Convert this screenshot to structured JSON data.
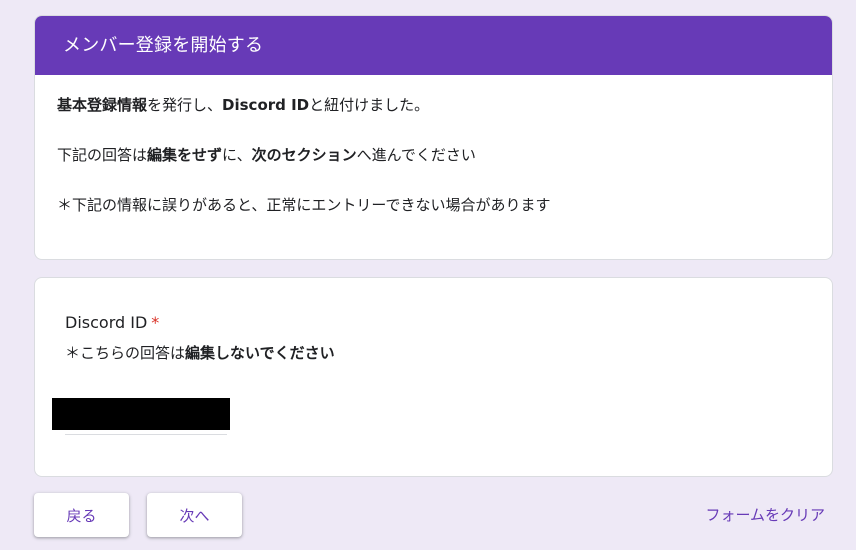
{
  "section": {
    "title": "メンバー登録を開始する",
    "desc1": {
      "b1": "基本登録情報",
      "t1": "を発行し、",
      "b2": "Discord ID",
      "t2": "と紐付けました。"
    },
    "desc2": {
      "t1": "下記の回答は",
      "b1": "編集をせず",
      "t2": "に、",
      "b2": "次のセクション",
      "t3": "へ進んでください"
    },
    "desc3": "＊下記の情報に誤りがあると、正常にエントリーできない場合があります"
  },
  "question": {
    "title": "Discord ID",
    "required_mark": "*",
    "help": {
      "t1": "＊こちらの回答は",
      "b1": "編集しないでください"
    },
    "value": ""
  },
  "nav": {
    "back_label": "戻る",
    "next_label": "次へ",
    "clear_label": "フォームをクリア"
  },
  "colors": {
    "accent": "#673ab7",
    "background": "#eee9f6",
    "required": "#d93025"
  }
}
